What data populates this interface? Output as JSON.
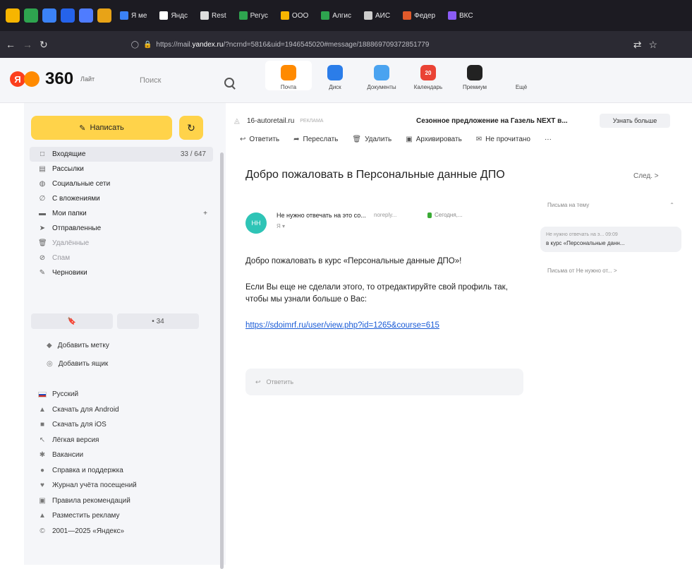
{
  "browser": {
    "tabs": [
      {
        "label": "",
        "color": "#f7b500"
      },
      {
        "label": "",
        "color": "#2ea44f"
      },
      {
        "label": "",
        "color": "#3b82f6"
      },
      {
        "label": "",
        "color": "#2563eb"
      },
      {
        "label": "",
        "color": "#4f7cff"
      },
      {
        "label": "",
        "color": "#e8a317"
      },
      {
        "label": "Я ме",
        "color": "#3b82f6"
      },
      {
        "label": "Яндс",
        "color": "#ffffff"
      },
      {
        "label": "Rest",
        "color": "#dddddd"
      },
      {
        "label": "Регус",
        "color": "#2ea44f"
      },
      {
        "label": "ООО",
        "color": "#f7b500"
      },
      {
        "label": "Алгис",
        "color": "#2ea44f"
      },
      {
        "label": "АИС",
        "color": "#cccccc"
      },
      {
        "label": "Федер",
        "color": "#e05a2b"
      },
      {
        "label": "ВКС",
        "color": "#8b5cf6"
      }
    ],
    "url_prefix": "https://mail.",
    "url_domain": "yandex.ru",
    "url_rest": "/?ncrnd=5816&uid=1946545020#message/188869709372851779"
  },
  "header": {
    "logo_mark": "Я",
    "logo_text": "360",
    "logo_sub": "Лайт",
    "search_placeholder": "Поиск",
    "services": [
      {
        "label": "Почта",
        "color": "#ff8a00",
        "badge": ""
      },
      {
        "label": "Диск",
        "color": "#2b7de9",
        "badge": ""
      },
      {
        "label": "Документы",
        "color": "#4aa3f0",
        "badge": ""
      },
      {
        "label": "Календарь",
        "color": "#ea4335",
        "badge": "20"
      },
      {
        "label": "Премиум",
        "color": "#222222",
        "badge": ""
      },
      {
        "label": "Ещё",
        "color": "#f5f6f9",
        "badge": ""
      }
    ]
  },
  "sidebar": {
    "compose_label": "Написать",
    "folders": [
      {
        "label": "Входящие",
        "icon": "□",
        "count": "33 / 647",
        "selected": true,
        "dim": false
      },
      {
        "label": "Рассылки",
        "icon": "▤",
        "count": "",
        "selected": false,
        "dim": false
      },
      {
        "label": "Социальные сети",
        "icon": "◍",
        "count": "",
        "selected": false,
        "dim": false
      },
      {
        "label": "С вложениями",
        "icon": "∅",
        "count": "",
        "selected": false,
        "dim": false
      },
      {
        "label": "Мои папки",
        "icon": "▬",
        "count": "+",
        "selected": false,
        "dim": false
      },
      {
        "label": "Отправленные",
        "icon": "➤",
        "count": "",
        "selected": false,
        "dim": false
      },
      {
        "label": "Удалённые",
        "icon": "🗑",
        "count": "",
        "selected": false,
        "dim": true
      },
      {
        "label": "Спам",
        "icon": "⊘",
        "count": "",
        "selected": false,
        "dim": true
      },
      {
        "label": "Черновики",
        "icon": "✎",
        "count": "",
        "selected": false,
        "dim": false
      }
    ],
    "bookmark_badge": "",
    "unread_badge": "• 34",
    "labels": [
      {
        "label": "Добавить метку",
        "icon": "◆"
      },
      {
        "label": "Добавить ящик",
        "icon": "◎"
      }
    ],
    "links": [
      {
        "label": "Русский",
        "icon": "flag"
      },
      {
        "label": "Скачать для Android",
        "icon": "▲"
      },
      {
        "label": "Скачать для iOS",
        "icon": "■"
      },
      {
        "label": "Лёгкая версия",
        "icon": "↖"
      },
      {
        "label": "Вакансии",
        "icon": "✱"
      },
      {
        "label": "Справка и поддержка",
        "icon": "●"
      },
      {
        "label": "Журнал учёта посещений",
        "icon": "♥"
      },
      {
        "label": "Правила рекомендаций",
        "icon": "▣"
      },
      {
        "label": "Разместить рекламу",
        "icon": "▲"
      },
      {
        "label": "2001—2025 «Яндекс»",
        "icon": "©"
      }
    ]
  },
  "ad": {
    "source": "16-autoretail.ru",
    "tag": "РЕКЛАМА",
    "title": "Сезонное предложение на Газель NEXT в...",
    "button": "Узнать больше"
  },
  "toolbar": {
    "reply": "Ответить",
    "forward": "Переслать",
    "delete": "Удалить",
    "archive": "Архивировать",
    "unread": "Не прочитано",
    "more": "···"
  },
  "message": {
    "subject": "Добро пожаловать в Персональные данные ДПО",
    "next_label": "След. >",
    "avatar_initials": "НН",
    "sender_name": "Не нужно отвечать на это со...",
    "sender_email": "noreply...",
    "date": "Сегодня,...",
    "to": "Я ▾",
    "body_p1": "Добро пожаловать в курс «Персональные данные ДПО»!",
    "body_p2": "Если Вы еще не сделали этого, то отредактируйте свой профиль так, чтобы мы узнали больше о Вас:",
    "link": "https://sdoimrf.ru/user/view.php?id=1265&course=615",
    "reply_placeholder": "Ответить"
  },
  "thread": {
    "header": "Письма на тему",
    "item_from": "Не нужно отвечать на э... 09:09",
    "item_subject": "в курс «Персональные данн...",
    "more": "Письма от Не нужно от... >"
  }
}
